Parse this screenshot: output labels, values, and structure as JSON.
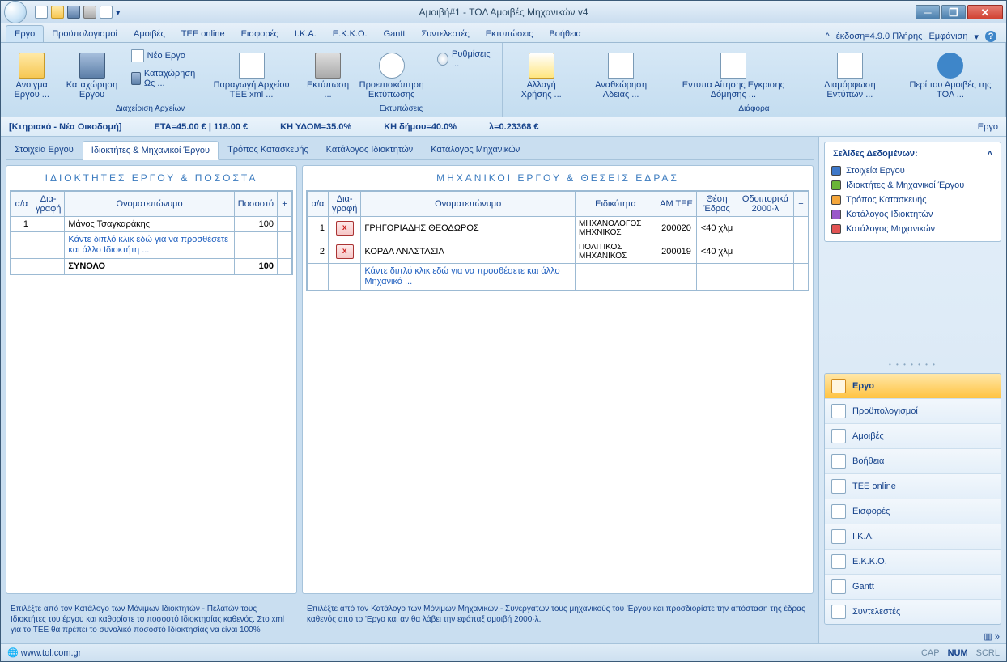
{
  "window": {
    "title": "Αμοιβή#1 - ΤΟΛ Αμοιβές Μηχανικών v4"
  },
  "ribbon": {
    "tabs": [
      "Εργο",
      "Προϋπολογισμοί",
      "Αμοιβές",
      "ΤΕΕ online",
      "Εισφορές",
      "Ι.Κ.Α.",
      "Ε.Κ.Κ.Ο.",
      "Gantt",
      "Συντελεστές",
      "Εκτυπώσεις",
      "Βοήθεια"
    ],
    "version": "έκδοση=4.9.0 Πλήρης",
    "appearance": "Εμφάνιση",
    "groups": {
      "files": {
        "label": "Διαχείριση Αρχείων",
        "open": "Ανοιγμα Εργου ...",
        "save": "Καταχώρηση Εργου",
        "new": "Νέο Εργο",
        "saveas": "Καταχώρηση Ως ...",
        "xml": "Παραγωγή Αρχείου ΤΕΕ xml ..."
      },
      "print": {
        "label": "Εκτυπώσεις",
        "print": "Εκτύπωση ...",
        "preview": "Προεπισκόπηση Εκτύπωσης",
        "settings": "Ρυθμίσεις ..."
      },
      "misc": {
        "label": "Διάφορα",
        "a": "Αλλαγή Χρήσης ...",
        "b": "Αναθεώρηση Αδειας ...",
        "c": "Εντυπα Αίτησης Εγκρισης Δόμησης ...",
        "d": "Διαμόρφωση Εντύπων ...",
        "e": "Περί του Αμοιβές της ΤΟΛ ..."
      }
    }
  },
  "summary": {
    "project": "[Κτηριακό - Νέα Οικοδομή]",
    "eta": "ΕΤΑ=45.00 € | 118.00 €",
    "khydom": "ΚΗ ΥΔΟΜ=35.0%",
    "khdimou": "ΚΗ δήμου=40.0%",
    "lambda": "λ=0.23368 €",
    "right": "Εργο"
  },
  "subtabs": [
    "Στοιχεία Εργου",
    "Ιδιοκτήτες & Μηχανικοί Έργου",
    "Τρόπος Κατασκευής",
    "Κατάλογος Ιδιοκτητών",
    "Κατάλογος Μηχανικών"
  ],
  "owners": {
    "title": "ΙΔΙΟΚΤΗΤΕΣ ΕΡΓΟΥ & ΠΟΣΟΣΤΑ",
    "headers": {
      "aa": "α/α",
      "del": "Δια-\nγραφή",
      "name": "Ονοματεπώνυμο",
      "pct": "Ποσοστό",
      "plus": "+"
    },
    "rows": [
      {
        "aa": "1",
        "name": "Μάνος Τσαγκαράκης",
        "pct": "100"
      }
    ],
    "hint": "Κάντε διπλό κλικ εδώ για να προσθέσετε και άλλο Ιδιοκτήτη ...",
    "total_label": "ΣΥΝΟΛΟ",
    "total": "100",
    "tip": "Επιλέξτε από τον Κατάλογο των Μόνιμων Ιδιοκτητών - Πελατών τους Ιδιοκτήτες του έργου και καθορίστε το ποσοστό Ιδιοκτησίας καθενός. Στο xml για το ΤΕΕ θα πρέπει το συνολικό ποσοστό Ιδιοκτησίας να είναι 100%"
  },
  "engineers": {
    "title": "ΜΗΧΑΝΙΚΟΙ ΕΡΓΟΥ & ΘΕΣΕΙΣ ΕΔΡΑΣ",
    "headers": {
      "aa": "α/α",
      "del": "Δια-\nγραφή",
      "name": "Ονοματεπώνυμο",
      "spec": "Ειδικότητα",
      "am": "ΑΜ ΤΕΕ",
      "seat": "Θέση Έδρας",
      "travel": "Οδοιπορικά 2000·λ",
      "plus": "+"
    },
    "rows": [
      {
        "aa": "1",
        "name": "ΓΡΗΓΟΡΙΑΔΗΣ ΘΕΟΔΩΡΟΣ",
        "spec": "ΜΗΧΑΝΟΛΟΓΟΣ ΜΗΧΝΙΚΟΣ",
        "am": "200020",
        "seat": "<40 χλμ",
        "travel": ""
      },
      {
        "aa": "2",
        "name": "ΚΟΡΔΑ ΑΝΑΣΤΑΣΙΑ",
        "spec": "ΠΟΛΙΤΙΚΟΣ ΜΗΧΑΝΙΚΟΣ",
        "am": "200019",
        "seat": "<40 χλμ",
        "travel": ""
      }
    ],
    "hint": "Κάντε διπλό κλικ εδώ για να προσθέσετε και άλλο Μηχανικό ...",
    "tip": "Επιλέξτε από τον Κατάλογο των Μόνιμων Μηχανικών - Συνεργατών τους μηχανικούς του 'Εργου και προσδιορίστε την απόσταση της έδρας καθενός από το 'Εργο και αν θα λάβει την εφάπαξ αμοιβή 2000·λ."
  },
  "sidebar": {
    "pages_title": "Σελίδες Δεδομένων:",
    "pages": [
      {
        "label": "Στοιχεία Εργου",
        "color": "#3e78c9"
      },
      {
        "label": "Ιδιοκτήτες & Μηχανικοί Έργου",
        "color": "#6ab436"
      },
      {
        "label": "Τρόπος Κατασκευής",
        "color": "#f4a63a"
      },
      {
        "label": "Κατάλογος Ιδιοκτητών",
        "color": "#9a58c9"
      },
      {
        "label": "Κατάλογος Μηχανικών",
        "color": "#e25353"
      }
    ],
    "nav": [
      "Εργο",
      "Προϋπολογισμοί",
      "Αμοιβές",
      "Βοήθεια",
      "ΤΕΕ online",
      "Εισφορές",
      "Ι.Κ.Α.",
      "Ε.Κ.Κ.Ο.",
      "Gantt",
      "Συντελεστές"
    ]
  },
  "status": {
    "url": "www.tol.com.gr",
    "cap": "CAP",
    "num": "NUM",
    "scrl": "SCRL"
  }
}
